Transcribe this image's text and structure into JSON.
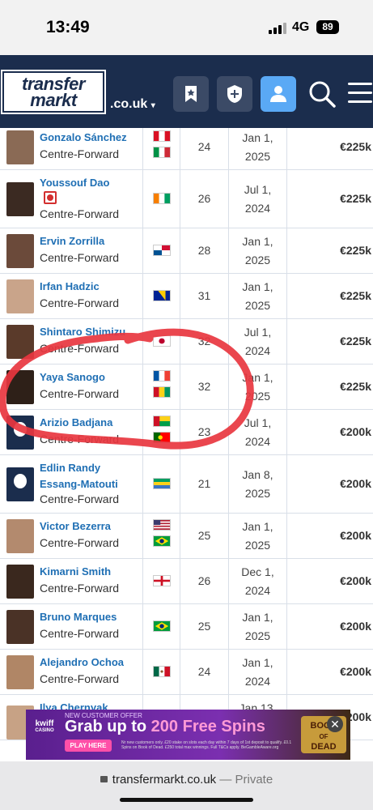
{
  "status": {
    "time": "13:49",
    "network": "4G",
    "battery": "89"
  },
  "header": {
    "logo_line1": "transfer",
    "logo_line2": "markt",
    "domain": ".co.uk"
  },
  "rows": [
    {
      "name": "Gonzalo Sánchez",
      "position": "Centre-Forward",
      "age": "24",
      "date1": "Jan 1,",
      "date2": "2025",
      "value": "€225k",
      "flags": [
        "peru",
        "italy"
      ]
    },
    {
      "name": "Youssouf Dao",
      "position": "Centre-Forward",
      "age": "26",
      "date1": "Jul 1,",
      "date2": "2024",
      "value": "€225k",
      "flags": [
        "ivory-coast"
      ]
    },
    {
      "name": "Ervin Zorrilla",
      "position": "Centre-Forward",
      "age": "28",
      "date1": "Jan 1,",
      "date2": "2025",
      "value": "€225k",
      "flags": [
        "panama"
      ]
    },
    {
      "name": "Irfan Hadzic",
      "position": "Centre-Forward",
      "age": "31",
      "date1": "Jan 1,",
      "date2": "2025",
      "value": "€225k",
      "flags": [
        "bosnia"
      ]
    },
    {
      "name": "Shintaro Shimizu",
      "position": "Centre-Forward",
      "age": "32",
      "date1": "Jul 1,",
      "date2": "2024",
      "value": "€225k",
      "flags": [
        "japan"
      ]
    },
    {
      "name": "Yaya Sanogo",
      "position": "Centre-Forward",
      "age": "32",
      "date1": "Jan 1,",
      "date2": "2025",
      "value": "€225k",
      "flags": [
        "france",
        "guinea"
      ]
    },
    {
      "name": "Arizio Badjana",
      "position": "Centre-Forward",
      "age": "23",
      "date1": "Jul 1,",
      "date2": "2024",
      "value": "€200k",
      "flags": [
        "guinea-bissau",
        "portugal"
      ]
    },
    {
      "name": "Edlin Randy Essang-Matouti",
      "position": "Centre-Forward",
      "age": "21",
      "date1": "Jan 8,",
      "date2": "2025",
      "value": "€200k",
      "flags": [
        "gabon"
      ]
    },
    {
      "name": "Victor Bezerra",
      "position": "Centre-Forward",
      "age": "25",
      "date1": "Jan 1,",
      "date2": "2025",
      "value": "€200k",
      "flags": [
        "usa",
        "brazil"
      ]
    },
    {
      "name": "Kimarni Smith",
      "position": "Centre-Forward",
      "age": "26",
      "date1": "Dec 1,",
      "date2": "2024",
      "value": "€200k",
      "flags": [
        "england"
      ]
    },
    {
      "name": "Bruno Marques",
      "position": "Centre-Forward",
      "age": "25",
      "date1": "Jan 1,",
      "date2": "2025",
      "value": "€200k",
      "flags": [
        "brazil"
      ]
    },
    {
      "name": "Alejandro Ochoa",
      "position": "Centre-Forward",
      "age": "24",
      "date1": "Jan 1,",
      "date2": "2024",
      "value": "€200k",
      "flags": [
        "mexico"
      ]
    },
    {
      "name": "Ilya Chernyak",
      "position": "",
      "age": "",
      "date1": "Jan 13,",
      "date2": "",
      "value": "€200k",
      "flags": []
    }
  ],
  "ad": {
    "brand": "kwiff",
    "brand_sub": "CASINO",
    "top_line": "NEW CUSTOMER OFFER",
    "headline_pre": "Grab up to ",
    "headline_hl": "200 Free Spins",
    "button": "PLAY HERE",
    "fine_print": "Nr new customers only. £20 stake on slots each day within 7 days of 1st deposit to qualify. £0.1 Spins on Book of Dead. £250 total max winnings. Full T&Cs apply. BeGambleAware.org",
    "game_line1": "BOOK",
    "game_line2": "OF",
    "game_line3": "DEAD"
  },
  "browser": {
    "url": "transfermarkt.co.uk",
    "mode": "— Private"
  }
}
